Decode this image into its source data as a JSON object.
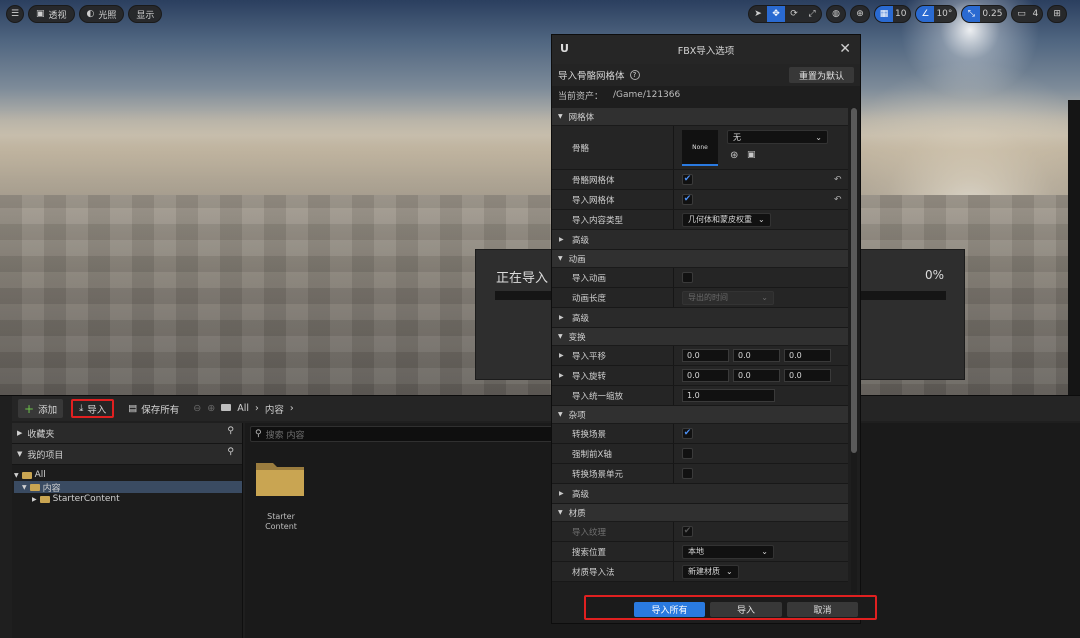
{
  "viewport": {
    "toolbar_left": [
      {
        "icon": "hamburger-menu-icon",
        "label": ""
      },
      {
        "icon": "perspective-cube-icon",
        "label": "透视"
      },
      {
        "icon": "lit-mode-icon",
        "label": "光照"
      },
      {
        "icon": "",
        "label": "显示"
      }
    ],
    "grid_snap_value": "10",
    "rotation_snap_value": "10°",
    "scale_snap_value": "0.25",
    "camera_speed_value": "4"
  },
  "progress": {
    "title": "正在导入",
    "percent_label": "0%",
    "percent": 0
  },
  "content_browser": {
    "add_label": "添加",
    "import_label": "导入",
    "save_all_label": "保存所有",
    "breadcrumb": [
      "All",
      "内容"
    ],
    "favorites_label": "收藏夹",
    "my_project_label": "我的项目",
    "tree": [
      "All",
      "内容",
      "StarterContent"
    ],
    "search_placeholder": "搜索 内容",
    "asset_label_line1": "Starter",
    "asset_label_line2": "Content"
  },
  "fbx": {
    "title": "FBX导入选项",
    "heading": "导入骨骼网格体",
    "reset_label": "重置为默认",
    "current_asset_label": "当前资产：",
    "current_asset_path": "/Game/121366",
    "sections": {
      "mesh": "网格体",
      "animation": "动画",
      "transform": "变换",
      "misc": "杂项",
      "material": "材质"
    },
    "advanced_label": "高级",
    "rows": {
      "skeleton": "骨骼",
      "skeleton_thumb": "None",
      "skeleton_value": "无",
      "skeletal_mesh": "骨骼网格体",
      "import_mesh": "导入网格体",
      "import_content_type": "导入内容类型",
      "import_content_type_value": "几何体和蒙皮权重",
      "import_animations": "导入动画",
      "animation_length": "动画长度",
      "animation_length_value": "导出的时间",
      "import_translation": "导入平移",
      "import_rotation": "导入旋转",
      "import_uniform_scale": "导入统一缩放",
      "translation_values": [
        "0.0",
        "0.0",
        "0.0"
      ],
      "rotation_values": [
        "0.0",
        "0.0",
        "0.0"
      ],
      "uniform_scale_value": "1.0",
      "convert_scene": "转换场景",
      "force_front_x": "强制前X轴",
      "convert_scene_unit": "转换场景单元",
      "import_textures": "导入纹理",
      "search_location": "搜索位置",
      "search_location_value": "本地",
      "material_import_method": "材质导入法",
      "material_import_method_value": "新建材质"
    },
    "checks": {
      "skeletal_mesh": true,
      "import_mesh": true,
      "import_animations": false,
      "convert_scene": true,
      "force_front_x": false,
      "convert_scene_unit": false,
      "import_textures": true
    },
    "footer": {
      "import_all": "导入所有",
      "import": "导入",
      "cancel": "取消"
    }
  },
  "colors": {
    "accent_blue": "#2a7ae0",
    "highlight_red": "#e02020",
    "folder_yellow": "#c9a552"
  }
}
